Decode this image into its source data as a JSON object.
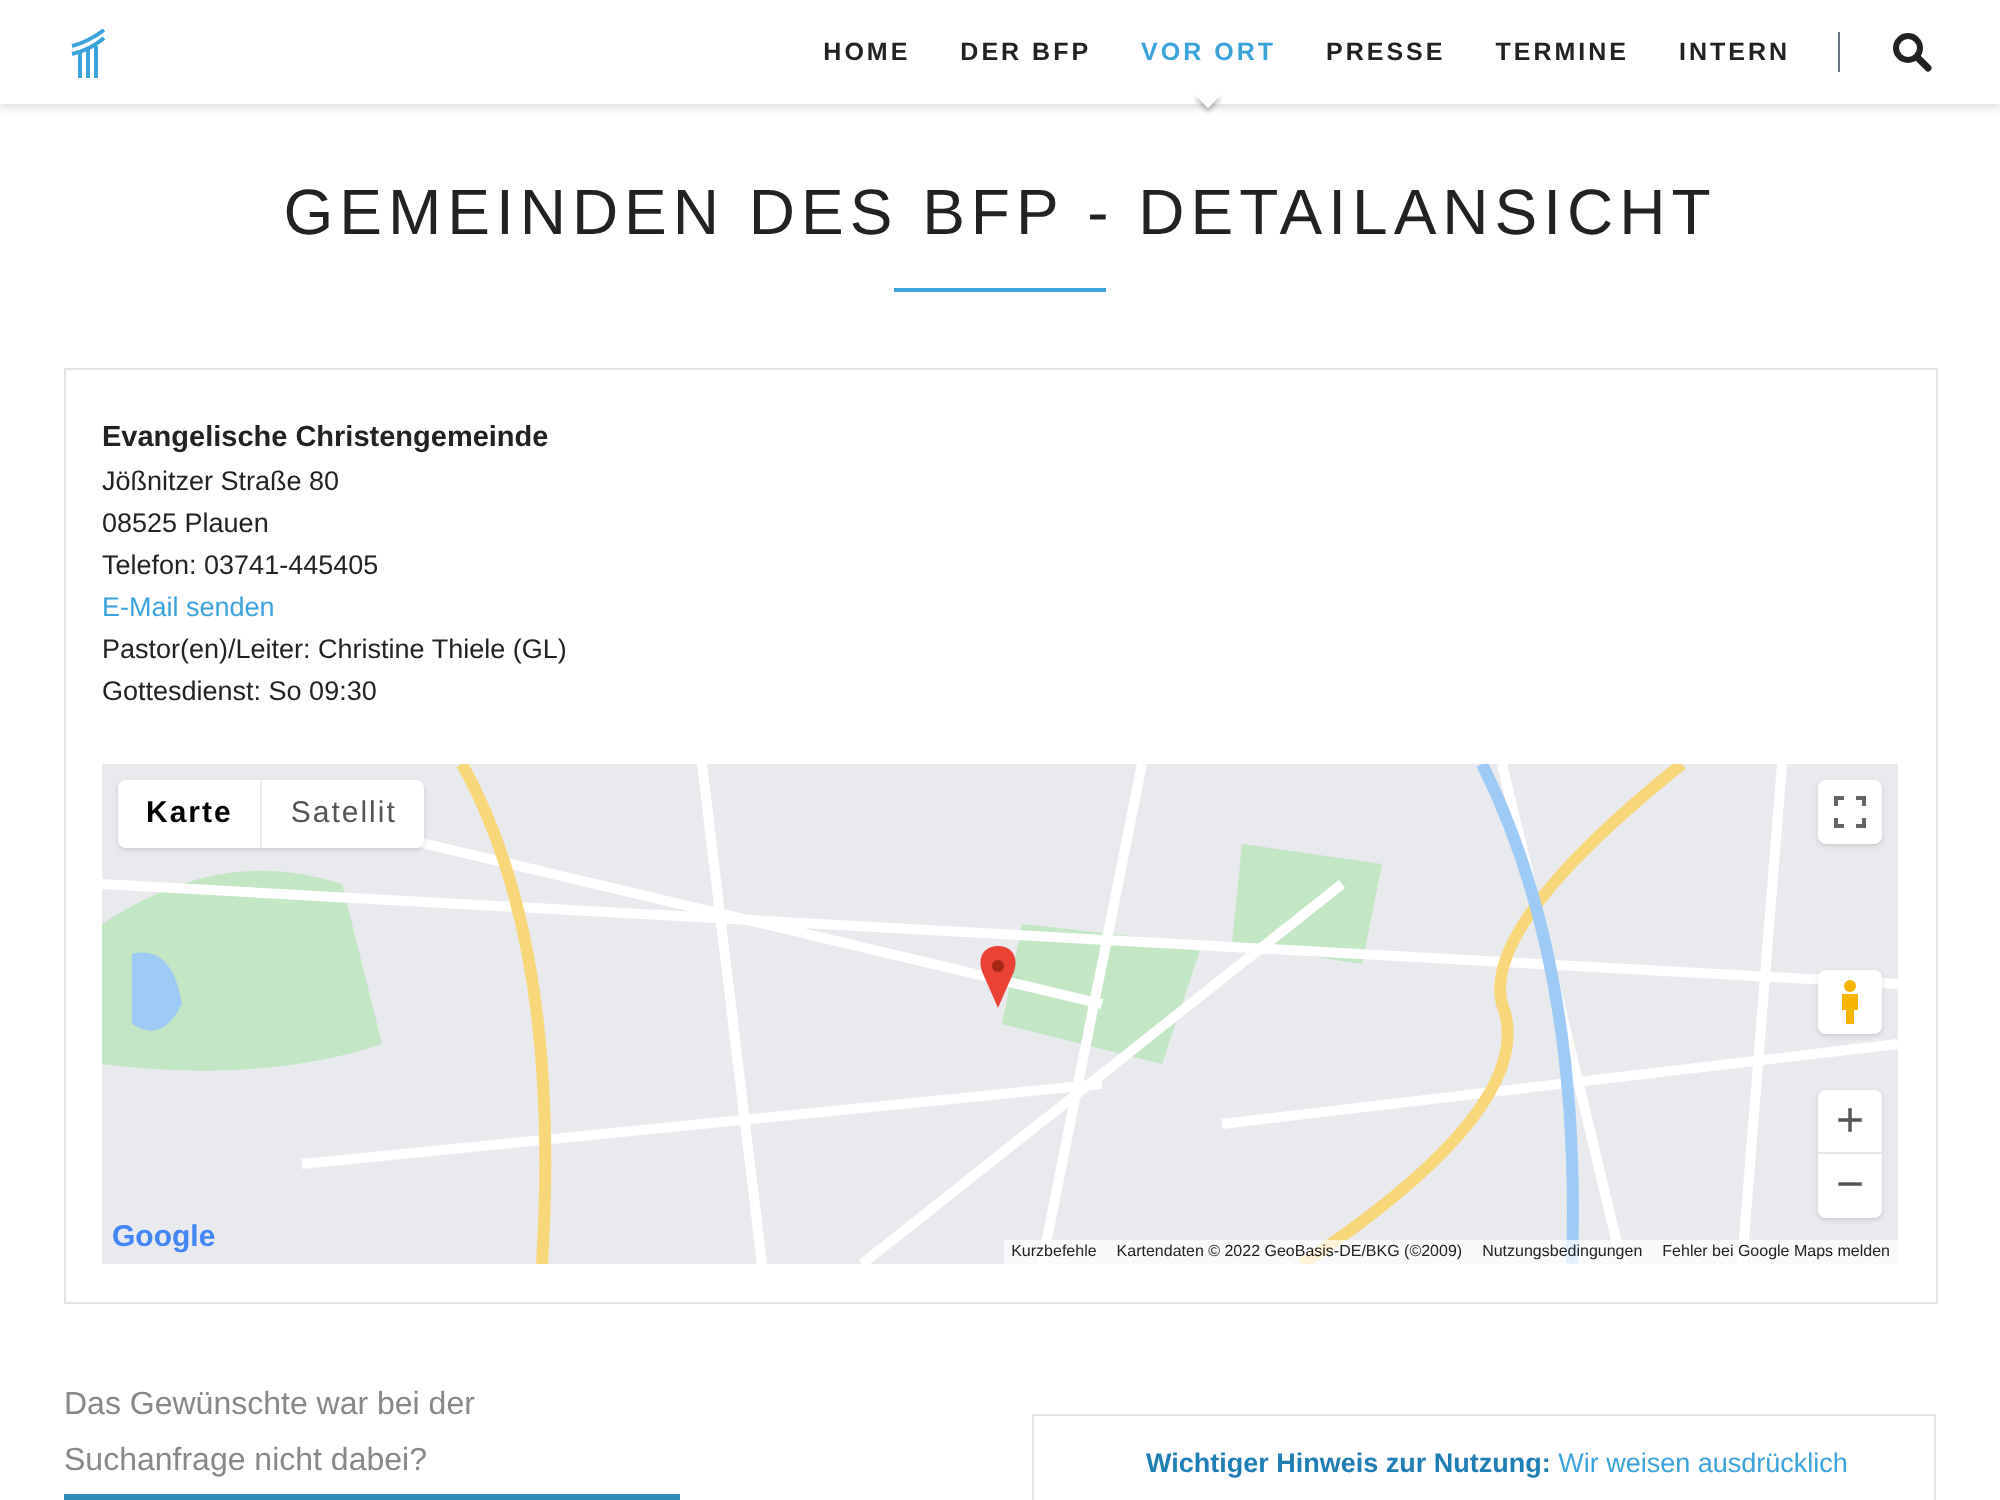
{
  "nav": {
    "items": [
      {
        "label": "HOME",
        "selected": false
      },
      {
        "label": "DER BFP",
        "selected": false
      },
      {
        "label": "VOR ORT",
        "selected": true
      },
      {
        "label": "PRESSE",
        "selected": false
      },
      {
        "label": "TERMINE",
        "selected": false
      },
      {
        "label": "INTERN",
        "selected": false
      }
    ]
  },
  "page_title": "GEMEINDEN DES BFP - DETAILANSICHT",
  "church": {
    "name": "Evangelische Christengemeinde",
    "lines": [
      {
        "kind": "text",
        "text": "Jößnitzer Straße 80"
      },
      {
        "kind": "text",
        "text": "08525 Plauen"
      },
      {
        "kind": "text",
        "text": "Telefon: 03741-445405"
      },
      {
        "kind": "link",
        "text": "E-Mail senden"
      },
      {
        "kind": "text",
        "text": "Pastor(en)/Leiter: Christine Thiele (GL)"
      },
      {
        "kind": "text",
        "text": "Gottesdienst: So 09:30"
      }
    ]
  },
  "map": {
    "map_types": [
      {
        "label": "Karte",
        "selected": true
      },
      {
        "label": "Satellit",
        "selected": false
      }
    ],
    "zoom_in": "+",
    "zoom_out": "−",
    "attribution": [
      "Kurzbefehle",
      "Kartendaten © 2022 GeoBasis-DE/BKG (©2009)",
      "Nutzungsbedingungen",
      "Fehler bei Google Maps melden"
    ],
    "logo": "Google"
  },
  "search_hint": "Das Gewünschte war bei der Suchanfrage nicht dabei?",
  "notice": {
    "lead": "Wichtiger Hinweis zur Nutzung:",
    "text": "Wir weisen ausdrücklich"
  }
}
